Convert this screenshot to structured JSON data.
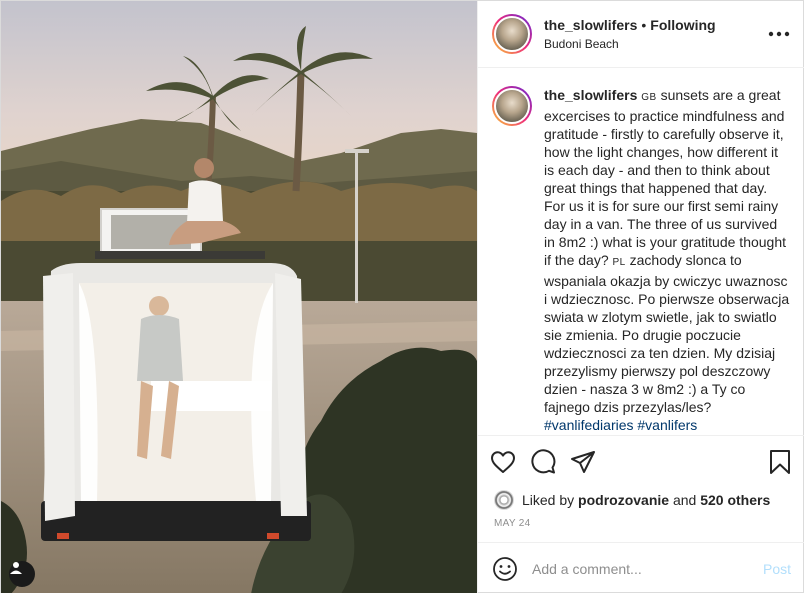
{
  "post": {
    "username": "the_slowlifers",
    "separator": "•",
    "follow_state": "Following",
    "location": "Budoni Beach",
    "more_icon": "more-horizontal-icon"
  },
  "caption": {
    "username": "the_slowlifers",
    "gb": "GB",
    "text1": "sunsets are a great excercises to practice mindfulness and gratitude - firstly to carefully observe it, how the light changes, how different it is each day - and then to think about great things that happened that day. For us it is for sure our first semi rainy day in a van. The three of us survived in 8m2 :) what is your gratitude thought if the day?",
    "pl": "PL",
    "text2": "zachody slonca to wspaniala okazja by cwiczyc uwaznosc i wdziecznosc. Po pierwsze obserwacja swiata w zlotym swietle, jak to swiatlo sie zmienia. Po drugie poczucie wdziecznosci za ten dzien. My dzisiaj przezylismy pierwszy pol deszczowy dzien - nasza 3 w 8m2 :) a Ty co fajnego dzis przezylas/les?",
    "hashtag1": "#vanlifediaries",
    "hashtag2": "#vanlifers"
  },
  "actions": {
    "like_icon": "heart-icon",
    "comment_icon": "comment-icon",
    "share_icon": "share-icon",
    "save_icon": "bookmark-icon"
  },
  "likes": {
    "prefix": "Liked by",
    "user": "podrozovanie",
    "and": "and",
    "others": "520 others"
  },
  "date": "MAY 24",
  "comment": {
    "placeholder": "Add a comment...",
    "post_label": "Post"
  },
  "colors": {
    "link": "#00376b",
    "post_disabled": "#b2dffc",
    "muted": "#8e8e8e"
  }
}
